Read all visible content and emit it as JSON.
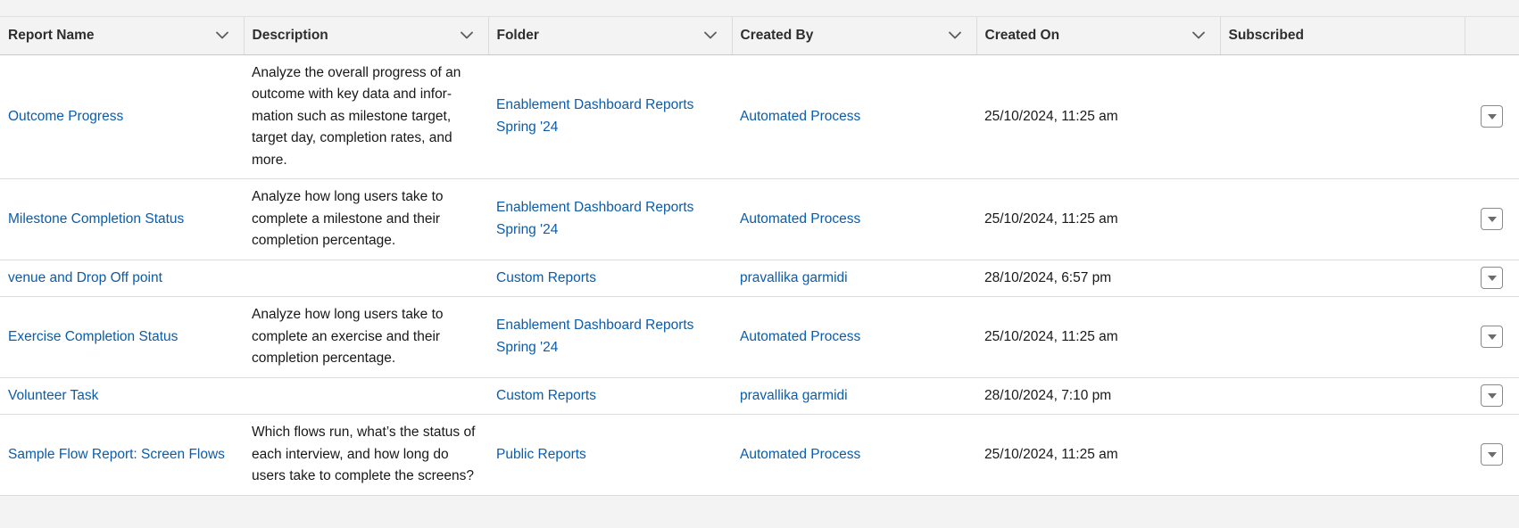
{
  "table": {
    "columns": [
      {
        "key": "name",
        "label": "Report Name",
        "sortable": true
      },
      {
        "key": "description",
        "label": "Description",
        "sortable": true
      },
      {
        "key": "folder",
        "label": "Folder",
        "sortable": true
      },
      {
        "key": "created_by",
        "label": "Created By",
        "sortable": true
      },
      {
        "key": "created_on",
        "label": "Created On",
        "sortable": true
      },
      {
        "key": "subscribed",
        "label": "Subscribed",
        "sortable": false
      }
    ],
    "rows": [
      {
        "name": "Outcome Progress",
        "description": "Analyze the overall progress of an outcome with key data and infor-mation such as milestone target, target day, completion rates, and more.",
        "folder": "Enablement Dashboard Reports Spring '24",
        "created_by": "Automated Process",
        "created_on": "25/10/2024, 11:25 am",
        "subscribed": ""
      },
      {
        "name": "Milestone Completion Status",
        "description": "Analyze how long users take to complete a milestone and their completion percentage.",
        "folder": "Enablement Dashboard Reports Spring '24",
        "created_by": "Automated Process",
        "created_on": "25/10/2024, 11:25 am",
        "subscribed": ""
      },
      {
        "name": "venue and Drop Off point",
        "description": "",
        "folder": "Custom Reports",
        "created_by": "pravallika garmidi",
        "created_on": "28/10/2024, 6:57 pm",
        "subscribed": ""
      },
      {
        "name": "Exercise Completion Status",
        "description": "Analyze how long users take to complete an exercise and their completion percentage.",
        "folder": "Enablement Dashboard Reports Spring '24",
        "created_by": "Automated Process",
        "created_on": "25/10/2024, 11:25 am",
        "subscribed": ""
      },
      {
        "name": "Volunteer Task",
        "description": "",
        "folder": "Custom Reports",
        "created_by": "pravallika garmidi",
        "created_on": "28/10/2024, 7:10 pm",
        "subscribed": ""
      },
      {
        "name": "Sample Flow Report: Screen Flows",
        "description": "Which flows run, what’s the status of each interview, and how long do users take to complete the screens?",
        "folder": "Public Reports",
        "created_by": "Automated Process",
        "created_on": "25/10/2024, 11:25 am",
        "subscribed": ""
      }
    ]
  },
  "icons": {
    "sort": "chevron-down-icon",
    "row_menu": "caret-down-icon"
  },
  "colors": {
    "link": "#0b5cab",
    "header_bg": "#f3f3f3",
    "border": "#dddbda"
  }
}
